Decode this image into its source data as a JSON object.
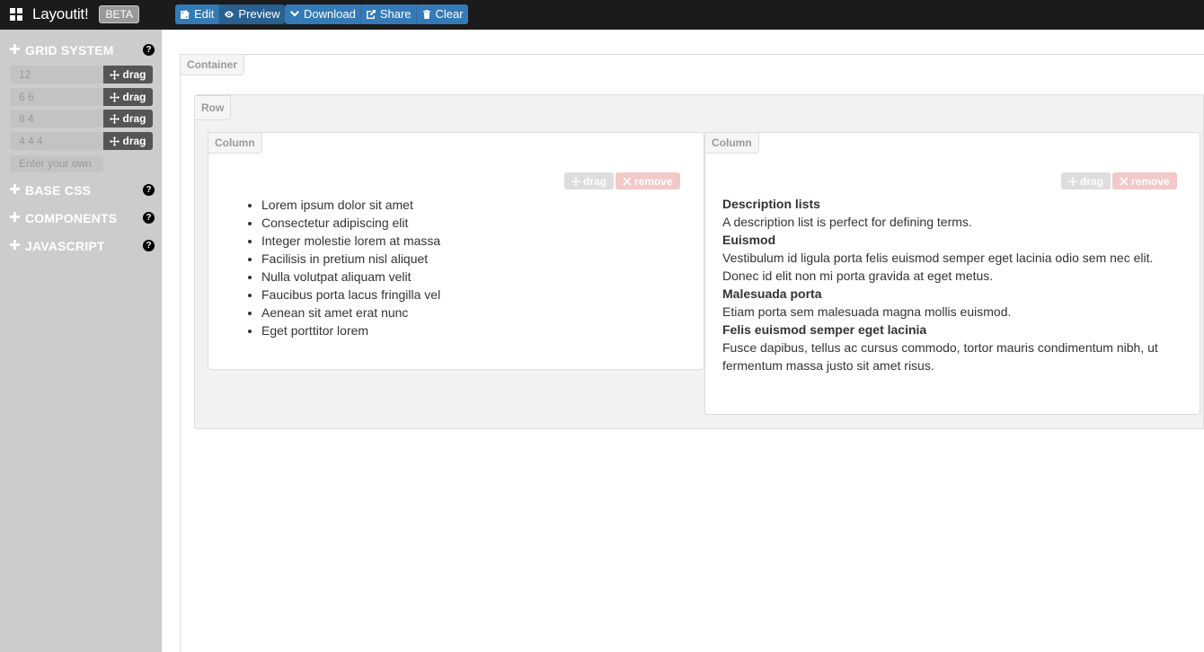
{
  "navbar": {
    "brand": "Layoutit!",
    "badge": "BETA",
    "mode_buttons": {
      "edit": "Edit",
      "preview": "Preview"
    },
    "action_buttons": {
      "download": "Download",
      "share": "Share",
      "clear": "Clear"
    }
  },
  "sidebar": {
    "grid_system": {
      "title": "GRID SYSTEM",
      "help": "?",
      "rows": [
        {
          "value": "12",
          "drag": "drag"
        },
        {
          "value": "6 6",
          "drag": "drag"
        },
        {
          "value": "8 4",
          "drag": "drag"
        },
        {
          "value": "4 4 4",
          "drag": "drag"
        }
      ],
      "own_placeholder": "Enter your own"
    },
    "sections": [
      {
        "title": "BASE CSS",
        "help": "?"
      },
      {
        "title": "COMPONENTS",
        "help": "?"
      },
      {
        "title": "JAVASCRIPT",
        "help": "?"
      }
    ]
  },
  "canvas": {
    "container_label": "Container",
    "row_label": "Row",
    "columns": [
      {
        "label": "Column",
        "drag": "drag",
        "remove": "remove",
        "list": [
          "Lorem ipsum dolor sit amet",
          "Consectetur adipiscing elit",
          "Integer molestie lorem at massa",
          "Facilisis in pretium nisl aliquet",
          "Nulla volutpat aliquam velit",
          "Faucibus porta lacus fringilla vel",
          "Aenean sit amet erat nunc",
          "Eget porttitor lorem"
        ]
      },
      {
        "label": "Column",
        "drag": "drag",
        "remove": "remove",
        "dl": [
          {
            "term": "Description lists",
            "desc": "A description list is perfect for defining terms."
          },
          {
            "term": "Euismod",
            "desc": "Vestibulum id ligula porta felis euismod semper eget lacinia odio sem nec elit. Donec id elit non mi porta gravida at eget metus."
          },
          {
            "term": "Malesuada porta",
            "desc": "Etiam porta sem malesuada magna mollis euismod."
          },
          {
            "term": "Felis euismod semper eget lacinia",
            "desc": "Fusce dapibus, tellus ac cursus commodo, tortor mauris condimentum nibh, ut fermentum massa justo sit amet risus."
          }
        ]
      }
    ]
  }
}
